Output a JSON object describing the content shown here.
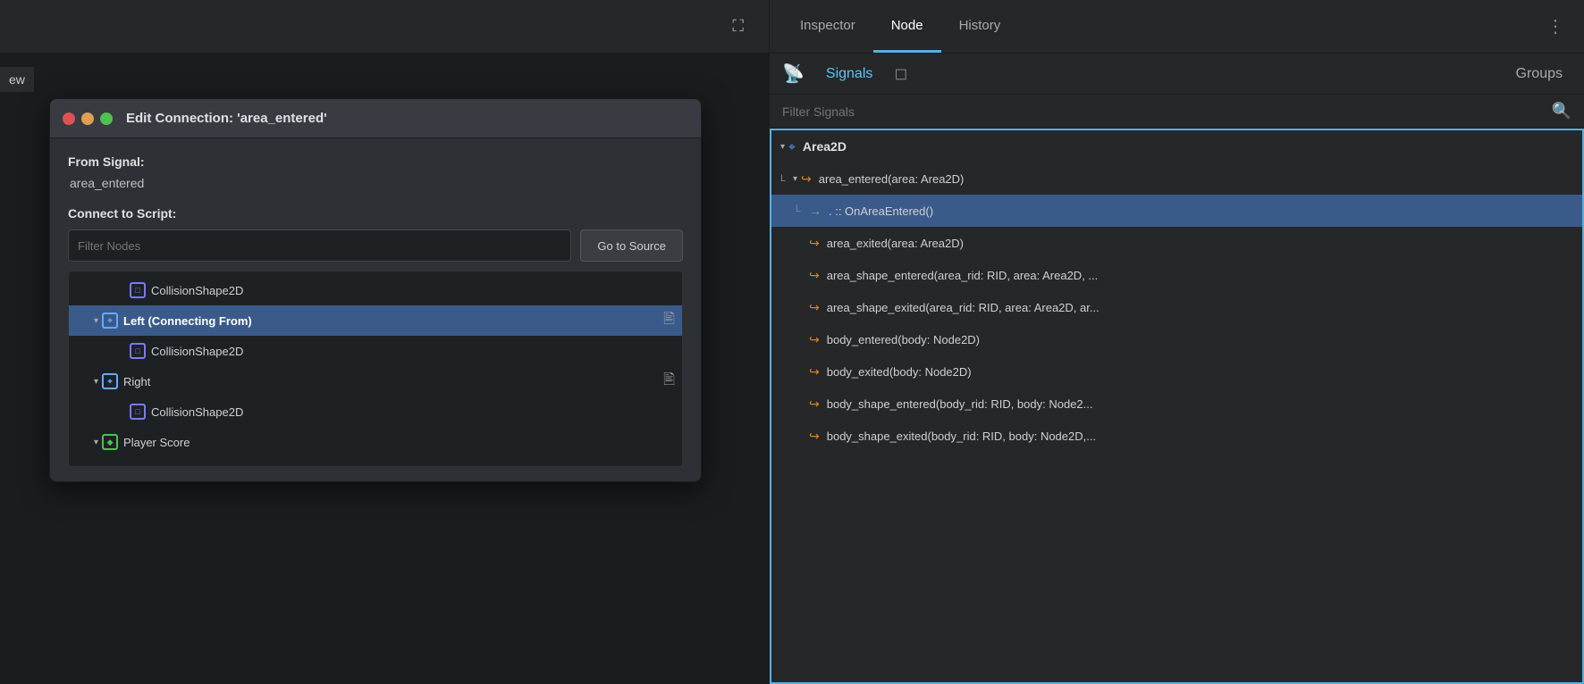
{
  "left": {
    "view_label": "ew",
    "expand_icon": "⛶"
  },
  "dialog": {
    "title": "Edit Connection: 'area_entered'",
    "from_signal_label": "From Signal:",
    "from_signal_value": "area_entered",
    "connect_to_script_label": "Connect to Script:",
    "filter_placeholder": "Filter Nodes",
    "goto_source_label": "Go to Source",
    "nodes": [
      {
        "indent": 60,
        "icon": "□",
        "label": "CollisionShape2D",
        "has_script": false,
        "selected": false,
        "type": "collision"
      },
      {
        "indent": 20,
        "arrow": "▾",
        "icon": "⌖",
        "label": "Left (Connecting From)",
        "has_script": true,
        "selected": true,
        "type": "area2d"
      },
      {
        "indent": 60,
        "icon": "□",
        "label": "CollisionShape2D",
        "has_script": false,
        "selected": false,
        "type": "collision"
      },
      {
        "indent": 20,
        "arrow": "▾",
        "icon": "⌖",
        "label": "Right",
        "has_script": true,
        "selected": false,
        "type": "area2d"
      },
      {
        "indent": 60,
        "icon": "□",
        "label": "CollisionShape2D",
        "has_script": false,
        "selected": false,
        "type": "collision"
      },
      {
        "indent": 20,
        "arrow": "▾",
        "icon": "◆",
        "label": "Player Score",
        "has_script": false,
        "selected": false,
        "type": "green"
      }
    ]
  },
  "right_panel": {
    "tabs": [
      {
        "label": "Inspector",
        "active": false
      },
      {
        "label": "Node",
        "active": true
      },
      {
        "label": "History",
        "active": false
      }
    ],
    "signals_label": "Signals",
    "groups_label": "Groups",
    "filter_placeholder": "Filter Signals",
    "signal_tree": [
      {
        "indent": 0,
        "arrow": "▾",
        "icon": "⌖",
        "icon_type": "blue",
        "label": "Area2D",
        "type": "root"
      },
      {
        "indent": 20,
        "arrow": "▾",
        "icon": "↪",
        "icon_type": "orange",
        "label": "area_entered(area: Area2D)",
        "type": "signal",
        "connector": "L"
      },
      {
        "indent": 50,
        "icon": "→",
        "icon_type": "green",
        "label": ". :: OnAreaEntered()",
        "type": "handler",
        "selected": true,
        "connector": "└"
      },
      {
        "indent": 20,
        "icon": "↪",
        "icon_type": "orange",
        "label": "area_exited(area: Area2D)",
        "type": "signal"
      },
      {
        "indent": 20,
        "icon": "↪",
        "icon_type": "orange",
        "label": "area_shape_entered(area_rid: RID, area: Area2D, ...",
        "type": "signal"
      },
      {
        "indent": 20,
        "icon": "↪",
        "icon_type": "orange",
        "label": "area_shape_exited(area_rid: RID, area: Area2D, ar...",
        "type": "signal"
      },
      {
        "indent": 20,
        "icon": "↪",
        "icon_type": "orange",
        "label": "body_entered(body: Node2D)",
        "type": "signal"
      },
      {
        "indent": 20,
        "icon": "↪",
        "icon_type": "orange",
        "label": "body_exited(body: Node2D)",
        "type": "signal"
      },
      {
        "indent": 20,
        "icon": "↪",
        "icon_type": "orange",
        "label": "body_shape_entered(body_rid: RID, body: Node2...",
        "type": "signal"
      },
      {
        "indent": 20,
        "icon": "↪",
        "icon_type": "orange",
        "label": "body_shape_exited(body_rid: RID, body: Node2D,...",
        "type": "signal"
      }
    ]
  }
}
